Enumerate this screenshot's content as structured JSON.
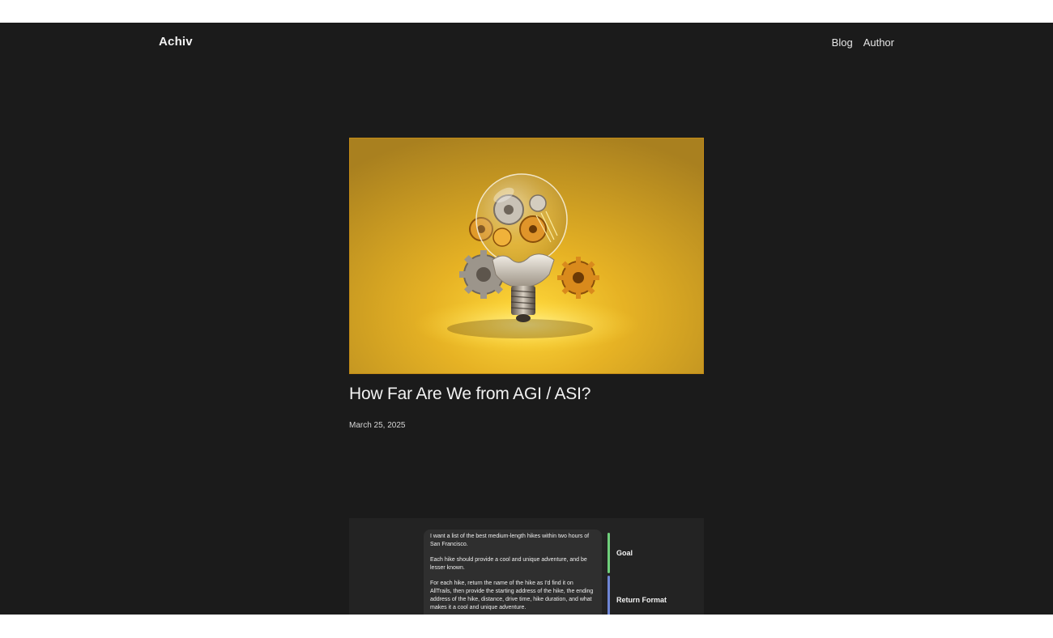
{
  "site": {
    "logo": "Achiv",
    "nav": [
      "Blog",
      "Author"
    ]
  },
  "post": {
    "title": "How Far Are We from AGI / ASI?",
    "date": "March 25, 2025",
    "hero_image": "lightbulb-with-gears-image"
  },
  "preview": {
    "prompt_paragraphs": [
      "I want a list of the best medium-length hikes within two hours of San Francisco.",
      "Each hike should provide a cool and unique adventure, and be lesser known.",
      "For each hike, return the name of the hike as I'd find it on AllTrails, then provide the starting address of the hike, the ending address of the hike, distance, drive time, hike duration, and what makes it a cool and unique adventure."
    ],
    "tags": [
      {
        "label": "Goal",
        "color": "#6fcf7b"
      },
      {
        "label": "Return Format",
        "color": "#6f86d6"
      }
    ]
  },
  "colors": {
    "background": "#1b1b1b",
    "hero_border": "#c28a16"
  }
}
